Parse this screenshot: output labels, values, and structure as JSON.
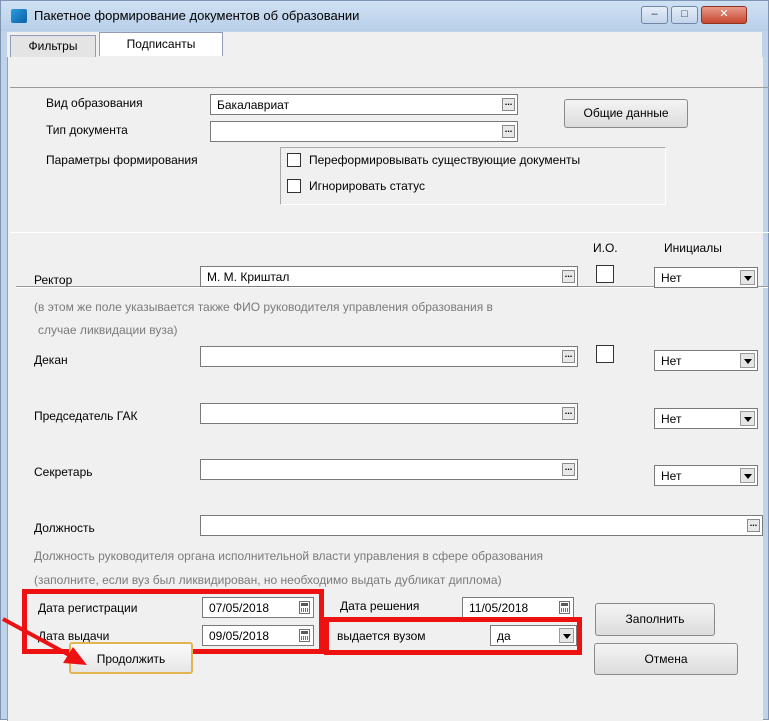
{
  "window": {
    "title": "Пакетное формирование документов об образовании",
    "minimize": "–",
    "maximize": "□",
    "close": "✕"
  },
  "tabs": [
    {
      "label": "Фильтры",
      "active": false
    },
    {
      "label": "Подписанты",
      "active": true
    }
  ],
  "general": {
    "education_type_label": "Вид образования",
    "education_type_value": "Бакалавриат",
    "doc_type_label": "Тип документа",
    "doc_type_value": "",
    "params_label": "Параметры формирования",
    "reform_label": "Переформировывать существующие документы",
    "ignore_status_label": "Игнорировать статус",
    "general_data_button": "Общие данные"
  },
  "signers": {
    "io_header": "И.О.",
    "initials_header": "Инициалы",
    "rector_label": "Ректор",
    "rector_value": "М. М. Криштал",
    "rector_initials": "Нет",
    "rector_hint_1": "(в этом же поле указывается также ФИО руководителя управления образования в",
    "rector_hint_2": "случае ликвидации вуза)",
    "dean_label": "Декан",
    "dean_value": "",
    "dean_initials": "Нет",
    "gak_label": "Председатель ГАК",
    "gak_value": "",
    "gak_initials": "Нет",
    "secretary_label": "Секретарь",
    "secretary_value": "",
    "secretary_initials": "Нет",
    "position_label": "Должность",
    "position_value": "",
    "position_hint_1": "Должность руководителя органа исполнительной власти управления в сфере образования",
    "position_hint_2": "(заполните, если вуз был ликвидирован, но необходимо выдать дубликат диплома)"
  },
  "dates": {
    "registration_label": "Дата регистрации",
    "registration_value": "07/05/2018",
    "issue_label": "Дата выдачи",
    "issue_value": "09/05/2018",
    "decision_label": "Дата решения",
    "decision_value": "11/05/2018",
    "issued_by_label": "выдается вузом",
    "issued_by_value": "да",
    "fill_button": "Заполнить"
  },
  "footer": {
    "continue_button": "Продолжить",
    "cancel_button": "Отмена"
  },
  "colors": {
    "highlight": "#ee1111",
    "panel": "#f0f0f0",
    "hint_text": "#7a7a7a"
  }
}
